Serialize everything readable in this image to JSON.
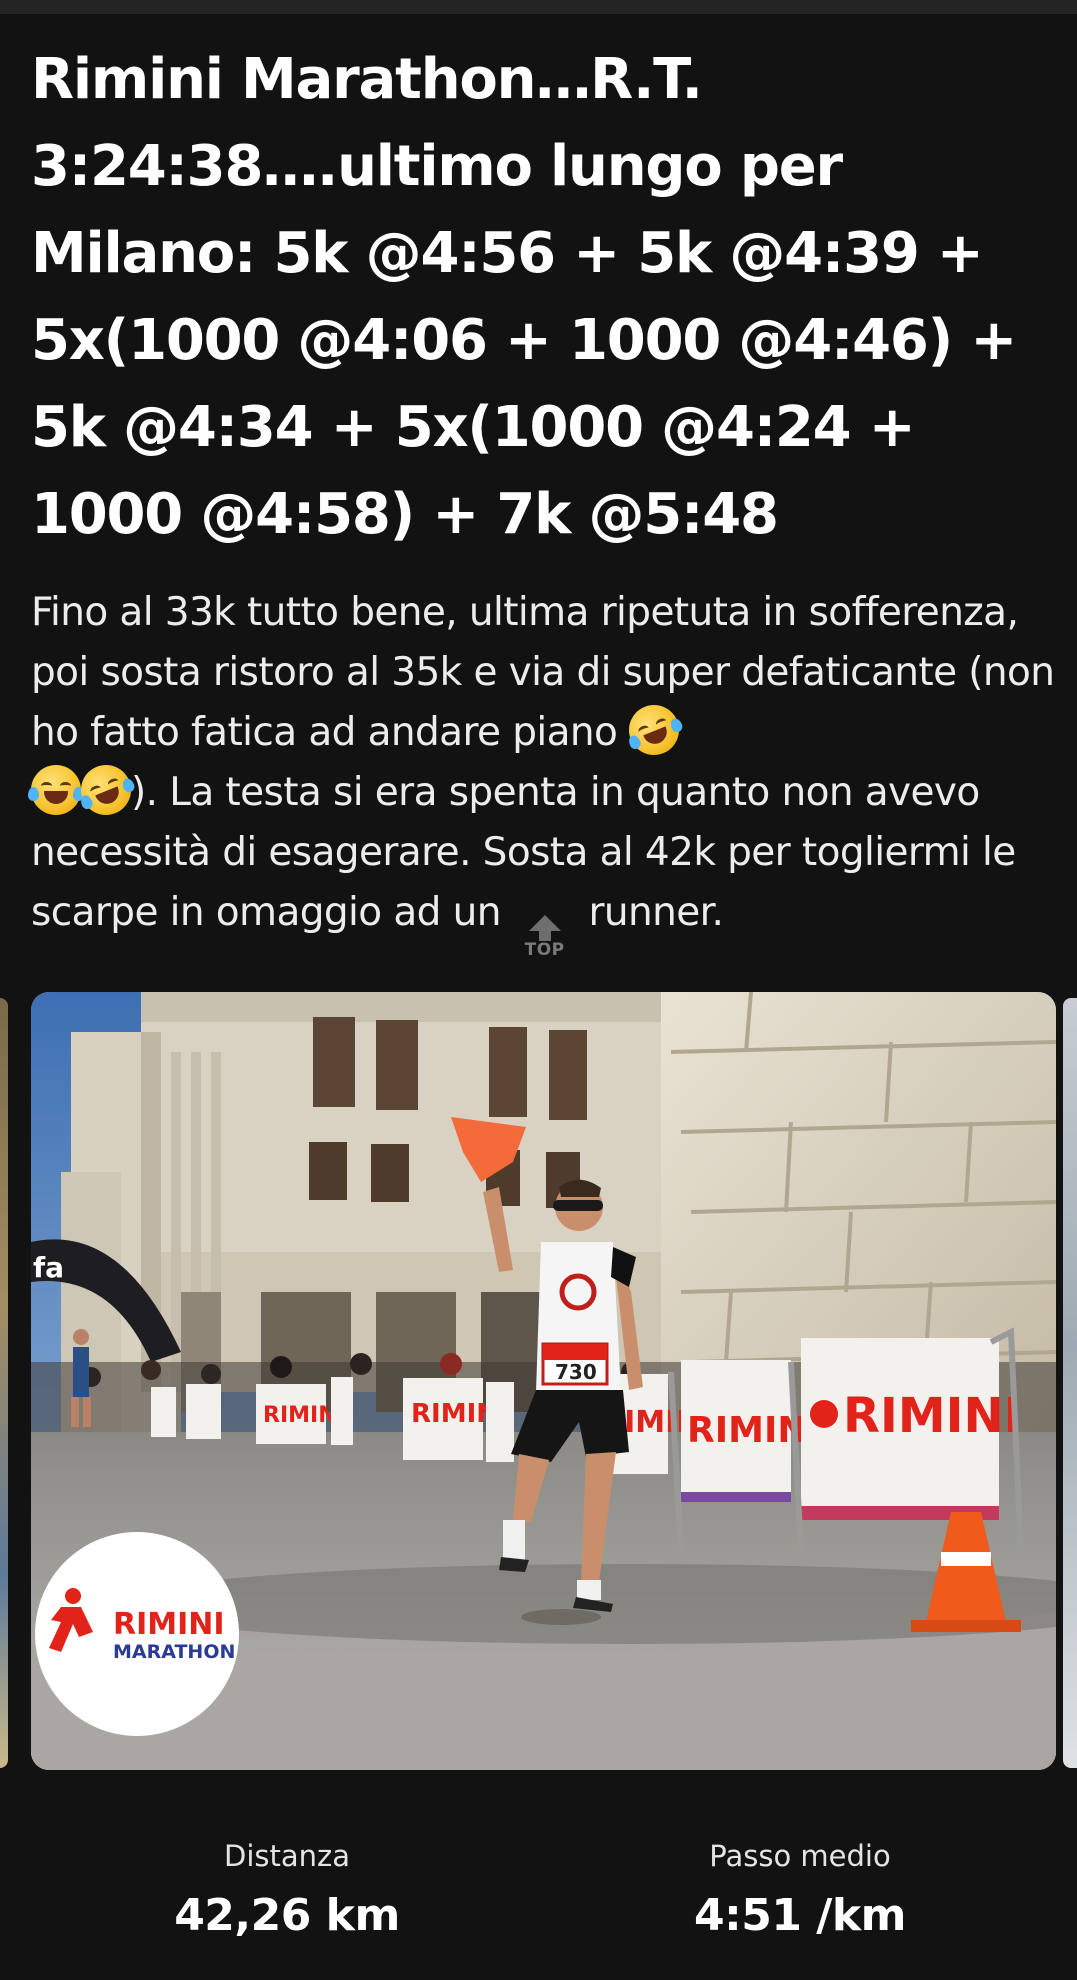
{
  "activity": {
    "title": "Rimini Marathon…R.T. 3:24:38….ultimo lungo per Milano: 5k @4:56 + 5k @4:39 + 5x(1000 @4:06 + 1000 @4:46) + 5k @4:34 + 5x(1000 @4:24 + 1000 @4:58) + 7k @5:48",
    "description": {
      "part1": "Fino al 33k tutto bene, ultima ripetuta in sofferenza, poi sosta ristoro al 35k e via di super defaticante (non ho fatto fatica ad andare piano ",
      "part2": "). La testa si era spenta in quanto non avevo necessità di esagerare. Sosta al 42k per togliermi le scarpe in omaggio ad un ",
      "part3": " runner.",
      "emoji_icons": [
        "rolling-on-floor-laughing-icon",
        "face-with-tears-of-joy-icon",
        "rolling-on-floor-laughing-icon"
      ],
      "top_glyph_label": "TOP"
    }
  },
  "photo": {
    "banner_text": "RIMINI",
    "arch_text": "fa",
    "runner_bib": "730",
    "logo_line1": "RIMINI",
    "logo_line2": "MARATHON"
  },
  "stats": [
    {
      "label": "Distanza",
      "value": "42,26 km"
    },
    {
      "label": "Passo medio",
      "value": "4:51 /km"
    }
  ],
  "colors": {
    "background": "#121212",
    "accent_red": "#e2231a",
    "logo_blue": "#2b3a97"
  }
}
